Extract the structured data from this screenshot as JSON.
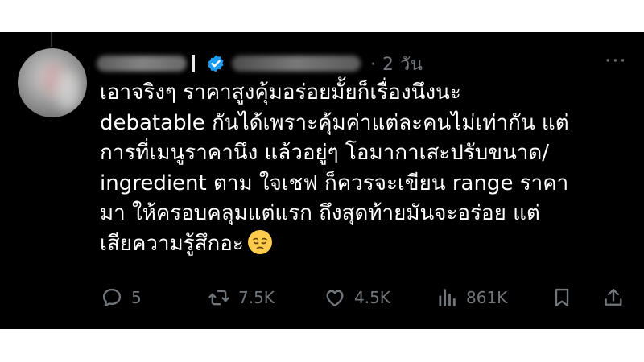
{
  "tweet": {
    "timestamp": "· 2 วัน",
    "more_label": "···",
    "lines": [
      "เอาจริงๆ ราคาสูงคุ้มอร่อยมั้ยก็เรื่องนึงนะ",
      "debatable กันได้เพราะคุ้มค่าแต่ละคนไม่เท่ากัน แต่",
      "การที่เมนูราคานึง แล้วอยู่ๆ โอมากาเสะปรับขนาด/",
      "ingredient ตาม ใจเชฟ ก็ควรจะเขียน range ราคา",
      "มา ให้ครอบคลุมแต่แรก ถึงสุดท้ายมันจะอร่อย แต่",
      "เสียความรู้สึกอะ"
    ],
    "emoji": "pensive-face",
    "actions": {
      "reply_count": "5",
      "retweet_count": "7.5K",
      "like_count": "4.5K",
      "view_count": "861K"
    }
  },
  "colors": {
    "background": "#000000",
    "text": "#ffffff",
    "muted": "#71767b",
    "verified": "#1d9bf0"
  },
  "icons": [
    "reply-icon",
    "retweet-icon",
    "like-icon",
    "views-icon",
    "bookmark-icon",
    "share-icon",
    "verified-badge-icon"
  ]
}
